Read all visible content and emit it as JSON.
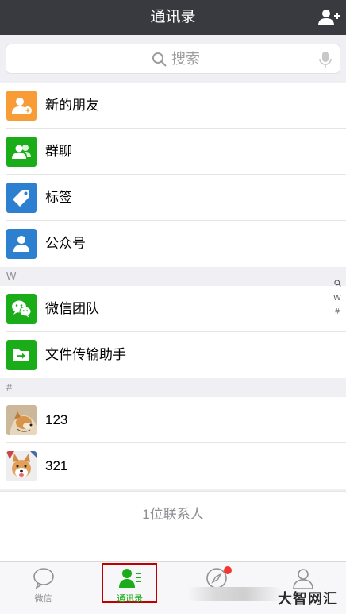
{
  "header": {
    "title": "通讯录",
    "add_icon": "add-contact-icon"
  },
  "search": {
    "placeholder": "搜索",
    "search_icon": "search-icon",
    "voice_icon": "microphone-icon"
  },
  "top_items": [
    {
      "label": "新的朋友",
      "icon": "new-friends-icon",
      "color": "#f79c36"
    },
    {
      "label": "群聊",
      "icon": "group-chat-icon",
      "color": "#1aad19"
    },
    {
      "label": "标签",
      "icon": "tag-icon",
      "color": "#2d7fd0"
    },
    {
      "label": "公众号",
      "icon": "official-accounts-icon",
      "color": "#2d7fd0"
    }
  ],
  "sections": [
    {
      "letter": "W",
      "items": [
        {
          "label": "微信团队",
          "icon": "wechat-team-icon",
          "color": "#1aad19"
        },
        {
          "label": "文件传输助手",
          "icon": "file-transfer-icon",
          "color": "#1aad19"
        }
      ]
    },
    {
      "letter": "#",
      "items": [
        {
          "label": "123",
          "icon": "shiba-avatar"
        },
        {
          "label": "321",
          "icon": "corgi-avatar"
        }
      ]
    }
  ],
  "index_bar": [
    "W",
    "#"
  ],
  "contact_count": "1位联系人",
  "tabs": [
    {
      "label": "微信",
      "icon": "chat-bubble-icon",
      "active": false
    },
    {
      "label": "通讯录",
      "icon": "contacts-icon",
      "active": true
    },
    {
      "label": "",
      "icon": "compass-icon",
      "active": false,
      "badge": true
    },
    {
      "label": "",
      "icon": "person-icon",
      "active": false
    }
  ],
  "watermark": "大智网汇",
  "colors": {
    "header": "#393a3f",
    "accent": "#1aad19",
    "badge": "#f43530"
  }
}
